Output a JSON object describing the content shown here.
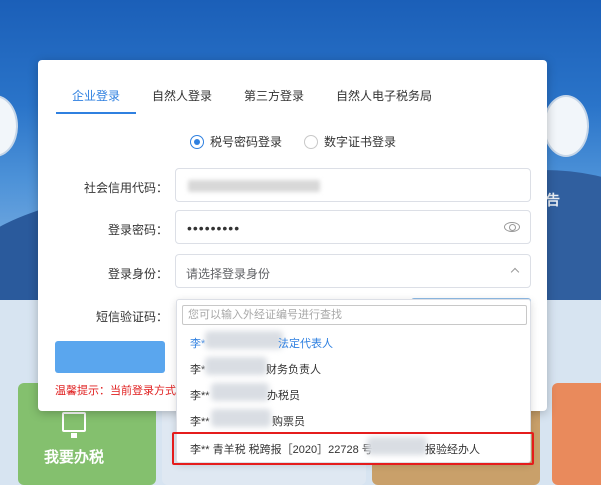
{
  "background": {
    "left_tile_label": "我要办税",
    "right_side_text": "告"
  },
  "tabs": [
    {
      "label": "企业登录",
      "active": true
    },
    {
      "label": "自然人登录",
      "active": false
    },
    {
      "label": "第三方登录",
      "active": false
    },
    {
      "label": "自然人电子税务局",
      "active": false
    }
  ],
  "login_mode": {
    "options": [
      {
        "label": "税号密码登录",
        "selected": true
      },
      {
        "label": "数字证书登录",
        "selected": false
      }
    ]
  },
  "form": {
    "credit_code_label": "社会信用代码：",
    "password_label": "登录密码：",
    "password_value": "•••••••••",
    "identity_label": "登录身份：",
    "identity_placeholder": "请选择登录身份",
    "sms_label": "短信验证码："
  },
  "tip": {
    "text": "温馨提示：当前登录方式"
  },
  "dropdown": {
    "search_placeholder": "您可以输入外经证编号进行查找",
    "items": [
      {
        "prefix": "李*",
        "role": "法定代表人",
        "selected": true
      },
      {
        "prefix": "李*",
        "role": "财务负责人",
        "selected": false
      },
      {
        "prefix": "李**",
        "role": "办税员",
        "selected": false
      },
      {
        "prefix": "李**",
        "role": "购票员",
        "selected": false
      },
      {
        "prefix": "李** 青羊税 税跨报［2020］22728 号",
        "role": "报验经办人",
        "selected": false
      }
    ]
  },
  "colors": {
    "accent": "#2f80e0",
    "warning": "#e02020",
    "highlight_box": "#e51c1c"
  }
}
